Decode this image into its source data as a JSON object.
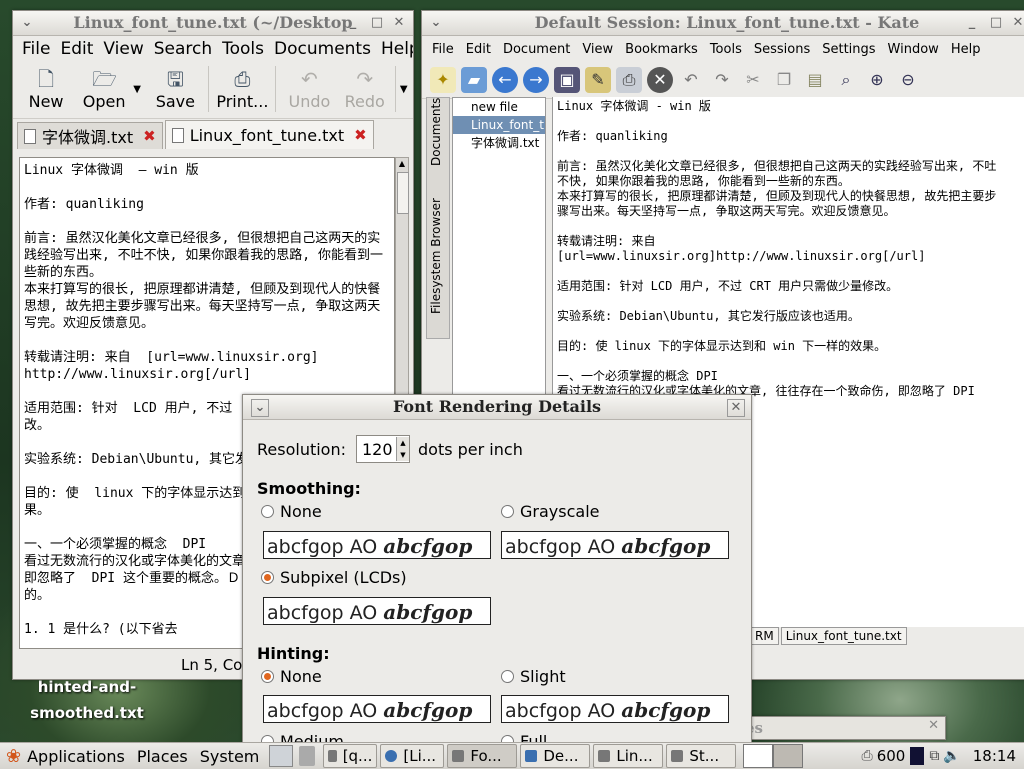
{
  "desktop": {
    "icon_label_lines": [
      "hinted-and-",
      "smoothed.txt"
    ]
  },
  "gedit": {
    "title": "Linux_font_tune.txt (~/Desktop",
    "menu": [
      "File",
      "Edit",
      "View",
      "Search",
      "Tools",
      "Documents",
      "Help"
    ],
    "toolbar": {
      "new": "New",
      "open": "Open",
      "save": "Save",
      "print": "Print...",
      "undo": "Undo",
      "redo": "Redo"
    },
    "tabs": [
      "字体微调.txt",
      "Linux_font_tune.txt"
    ],
    "content": "Linux 字体微调  – win 版\n\n作者: quanliking\n\n前言: 虽然汉化美化文章已经很多, 但很想把自己这两天的实践经验写出来, 不吐不快, 如果你跟着我的思路, 你能看到一些新的东西。\n本来打算写的很长, 把原理都讲清楚, 但顾及到现代人的快餐思想, 故先把主要步骤写出来。每天坚持写一点, 争取这两天写完。欢迎反馈意见。\n\n转载请注明: 来自  [url=www.linuxsir.org]\nhttp://www.linuxsir.org[/url]\n\n适用范围: 针对  LCD 用户, 不过  CRT 用户只需做少量修改。\n\n实验系统: Debian\\Ubuntu, 其它发行版应该也适用。\n\n目的: 使  linux 下的字体显示达到和  win 下一样的效果。\n\n一、一个必须掌握的概念  DPI\n看过无数流行的汉化或字体美化的文章, 往往存在一个致命伤, 即忽略了  DPI 这个重要的概念。ＤＰＩ 是什么? 请看下面的。\n\n1. 1 是什么? (以下省去",
    "status": "Ln 5, Co"
  },
  "kate": {
    "title": "Default Session: Linux_font_tune.txt - Kate",
    "menu": [
      "File",
      "Edit",
      "Document",
      "View",
      "Bookmarks",
      "Tools",
      "Sessions",
      "Settings",
      "Window",
      "Help"
    ],
    "side_tabs": [
      "Documents",
      "Filesystem Browser"
    ],
    "files": [
      "new file",
      "Linux_font_t",
      "字体微调.txt"
    ],
    "content": "Linux 字体微调 - win 版\n\n作者: quanliking\n\n前言: 虽然汉化美化文章已经很多, 但很想把自己这两天的实践经验写出来, 不吐\n不快, 如果你跟着我的思路, 你能看到一些新的东西。\n本来打算写的很长, 把原理都讲清楚, 但顾及到现代人的快餐思想, 故先把主要步\n骤写出来。每天坚持写一点, 争取这两天写完。欢迎反馈意见。\n\n转载请注明: 来自\n[url=www.linuxsir.org]http://www.linuxsir.org[/url]\n\n适用范围: 针对 LCD 用户, 不过 CRT 用户只需做少量修改。\n\n实验系统: Debian\\Ubuntu, 其它发行版应该也适用。\n\n目的: 使 linux 下的字体显示达到和 win 下一样的效果。\n\n一、一个必须掌握的概念 DPI\n看过无数流行的汉化或字体美化的文章, 往往存在一个致命伤, 即忽略了 DPI",
    "status": [
      "RM",
      "Linux_font_tune.txt"
    ]
  },
  "dialog": {
    "title": "Font Rendering Details",
    "resolution_label": "Resolution:",
    "resolution_value": "120",
    "resolution_unit": "dots per inch",
    "smoothing_label": "Smoothing:",
    "smoothing_options": [
      "None",
      "Grayscale",
      "Subpixel (LCDs)"
    ],
    "hinting_label": "Hinting:",
    "hinting_options": [
      "None",
      "Slight",
      "Medium",
      "Full"
    ],
    "sample_plain": "abcfgop AO ",
    "sample_italic": "abcfgop",
    "accent_color": "#e0661f"
  },
  "bg_window": {
    "title": "es"
  },
  "panel": {
    "menus": [
      "Applications",
      "Places",
      "System"
    ],
    "tasks": [
      "[q...",
      "[Li...",
      "Fo...",
      "De...",
      "Lin...",
      "St..."
    ],
    "volume": "600",
    "clock": "18:14"
  }
}
